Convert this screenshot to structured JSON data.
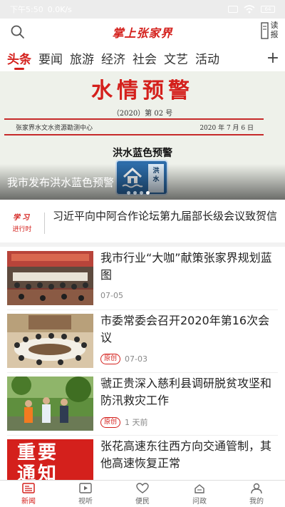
{
  "status_bar": {
    "time": "下午5:50",
    "speed": "0.0K/s",
    "battery": "64"
  },
  "header": {
    "title": "掌上张家界",
    "read_label_top": "读",
    "read_label_bottom": "报",
    "search_icon": "search-icon"
  },
  "tabs": [
    {
      "label": "头条",
      "active": true
    },
    {
      "label": "要闻",
      "active": false
    },
    {
      "label": "旅游",
      "active": false
    },
    {
      "label": "经济",
      "active": false
    },
    {
      "label": "社会",
      "active": false
    },
    {
      "label": "文艺",
      "active": false
    },
    {
      "label": "活动",
      "active": false
    }
  ],
  "tab_add": "+",
  "banner": {
    "doc_heading": "水情预警",
    "doc_number": "（2020）第 02 号",
    "doc_issuer": "张家界水文水资源勘测中心",
    "doc_date": "2020 年 7 月 6 日",
    "doc_subtitle": "洪水蓝色预警",
    "badge_text_1": "洪",
    "badge_text_2": "水",
    "caption": "我市发布洪水蓝色预警",
    "slide_count": 4,
    "active_slide": 3
  },
  "study": {
    "logo_top": "学习",
    "logo_bottom": "进行时",
    "headline": "习近平向中阿合作论坛第九届部长级会议致贺信"
  },
  "news": [
    {
      "title": "我市行业“大咖”献策张家界规划蓝图",
      "tag": "",
      "time": "07-05"
    },
    {
      "title": "市委常委会召开2020年第16次会议",
      "tag": "原创",
      "time": "07-03"
    },
    {
      "title": "虢正贵深入慈利县调研脱贫攻坚和防汛救灾工作",
      "tag": "原创",
      "time": "1 天前"
    },
    {
      "title": "张花高速东往西方向交通管制，其他高速恢复正常",
      "tag": "",
      "time": "",
      "thumb_text": "重要通知"
    }
  ],
  "bottom_nav": [
    {
      "label": "新闻",
      "icon": "news-icon",
      "active": true
    },
    {
      "label": "视听",
      "icon": "video-icon",
      "active": false
    },
    {
      "label": "便民",
      "icon": "heart-icon",
      "active": false
    },
    {
      "label": "问政",
      "icon": "question-icon",
      "active": false
    },
    {
      "label": "我的",
      "icon": "user-icon",
      "active": false
    }
  ],
  "colors": {
    "brand_red": "#d4201c",
    "flood_blue": "#2d6ca9"
  }
}
